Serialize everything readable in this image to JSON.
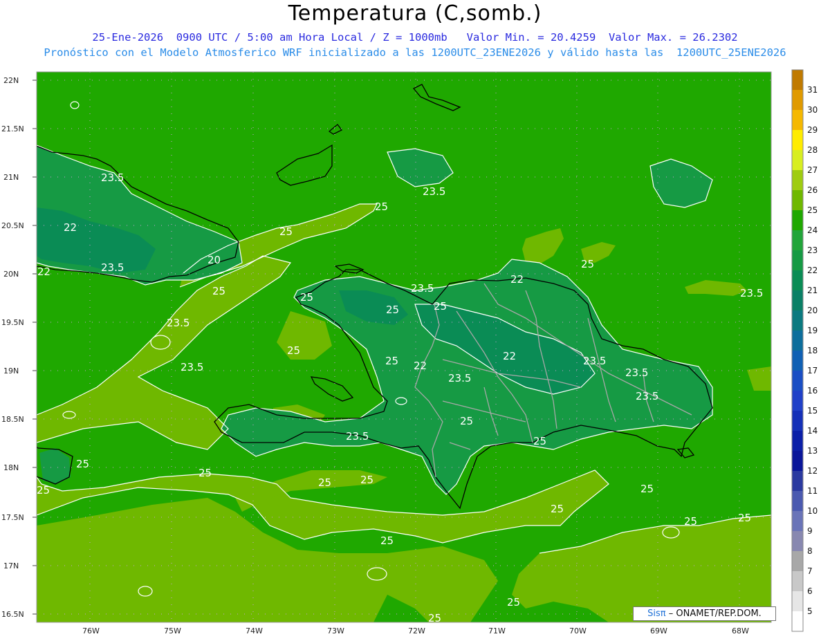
{
  "header": {
    "title": "Temperatura (C,somb.)",
    "subtitle_1": "25-Ene-2026  0900 UTC / 5:00 am Hora Local / Z = 1000mb   Valor Min. = 20.4259  Valor Max. = 26.2302",
    "subtitle_2": "Pronóstico con el Modelo Atmosferico WRF inicializado a las 1200UTC_23ENE2026 y válido hasta las  1200UTC_25ENE2026"
  },
  "axes": {
    "lat_labels": [
      "22N",
      "21.5N",
      "21N",
      "20.5N",
      "20N",
      "19.5N",
      "19N",
      "18.5N",
      "18N",
      "17.5N",
      "17N",
      "16.5N"
    ],
    "lon_labels": [
      "76W",
      "75W",
      "74W",
      "73W",
      "72W",
      "71W",
      "70W",
      "69W",
      "68W"
    ]
  },
  "colorbar": {
    "labels": [
      "31",
      "30",
      "29",
      "28",
      "27",
      "26",
      "25",
      "24",
      "23",
      "22",
      "21",
      "20",
      "19",
      "18",
      "17",
      "16",
      "15",
      "14",
      "13",
      "12",
      "11",
      "10",
      "9",
      "8",
      "7",
      "6",
      "5"
    ],
    "colors": [
      "#c07a00",
      "#e09a00",
      "#f5b800",
      "#ffec00",
      "#d8ee20",
      "#9fcc10",
      "#6fb800",
      "#1fa800",
      "#22a53a",
      "#169a44",
      "#0a8c55",
      "#0a8066",
      "#0b7a80",
      "#0d6e9c",
      "#1060b4",
      "#1a4ec4",
      "#2040c8",
      "#1530b8",
      "#0b1fa8",
      "#0a169a",
      "#2b3aa0",
      "#4b5ab0",
      "#6a74b8",
      "#8888b0",
      "#a8a8a8",
      "#c8c8c8",
      "#e6e6e6"
    ],
    "bottom_color": "#ffffff"
  },
  "contour_labels": [
    "23.5",
    "25",
    "25",
    "23.5",
    "22",
    "25",
    "22",
    "23.5",
    "20",
    "25",
    "23.5",
    "22",
    "23.5",
    "25",
    "25",
    "25",
    "23.5",
    "25",
    "22",
    "23.5",
    "25",
    "22",
    "23.5",
    "23.5",
    "23.5",
    "23.5",
    "25",
    "23.5",
    "25",
    "25",
    "25",
    "25",
    "25",
    "25",
    "25",
    "25",
    "25",
    "25",
    "25",
    "25",
    "25"
  ],
  "credit": {
    "logo": "Sisπ",
    "text": "– ONAMET/REP.DOM."
  }
}
